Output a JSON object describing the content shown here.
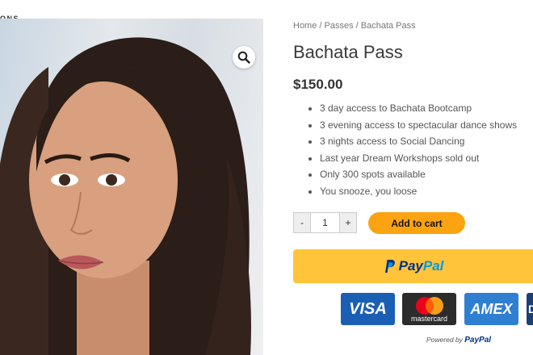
{
  "header": {
    "site_label_fragment": "ONS"
  },
  "product": {
    "image_alt": "Woman with long dark hair",
    "breadcrumb": {
      "home": "Home",
      "sep1": " / ",
      "passes": "Passes",
      "sep2": " / ",
      "current": "Bachata Pass"
    },
    "title": "Bachata Pass",
    "price": "$150.00",
    "features": [
      "3 day access to Bachata Bootcamp",
      "3 evening access to spectacular dance shows",
      "3 nights access to Social Dancing",
      "Last year Dream Workshops sold out",
      "Only 300 spots available",
      "You snooze, you loose"
    ],
    "quantity": {
      "minus": "-",
      "value": "1",
      "plus": "+"
    },
    "add_to_cart": "Add to cart"
  },
  "paypal": {
    "pay": "Pay",
    "pal": "Pal",
    "colors": {
      "button": "#ffc439",
      "dark_blue": "#003087",
      "light_blue": "#009cde"
    },
    "cards": {
      "visa": "VISA",
      "mastercard": "mastercard",
      "amex": "AMEX",
      "fourth": "D"
    },
    "powered_by": "Powered by",
    "powered_brand": "PayPal"
  },
  "accent": "#fca311"
}
